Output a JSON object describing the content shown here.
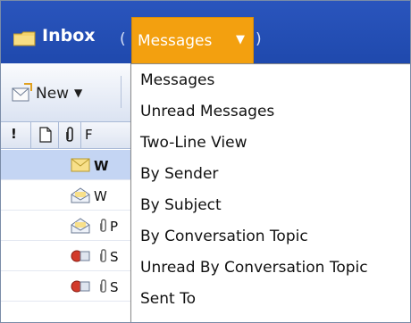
{
  "header": {
    "title": "Inbox",
    "paren_open": "(",
    "paren_close": ")",
    "view_label": "Messages",
    "view_caret": "▼"
  },
  "toolbar": {
    "new_label": "New",
    "new_caret": "▼"
  },
  "columns": {
    "importance": "!",
    "from_partial": "F"
  },
  "rows": [
    {
      "text": "W",
      "bold": true
    },
    {
      "text": "W",
      "bold": false
    },
    {
      "text": "P",
      "bold": false
    },
    {
      "text": "S",
      "bold": false
    },
    {
      "text": "S",
      "bold": false
    }
  ],
  "menu": {
    "items": [
      "Messages",
      "Unread Messages",
      "Two-Line View",
      "By Sender",
      "By Subject",
      "By Conversation Topic",
      "Unread By Conversation Topic",
      "Sent To"
    ]
  },
  "colors": {
    "header_blue": "#2a55bd",
    "view_orange": "#f3a00f",
    "selected_row": "#c4d5f3"
  },
  "icons": {
    "header": "folder-icon",
    "toolbar": "new-mail-icon",
    "rows": [
      "envelope-closed-icon",
      "envelope-open-icon",
      "envelope-open-icon",
      "reply-forward-icon",
      "reply-forward-icon"
    ]
  }
}
